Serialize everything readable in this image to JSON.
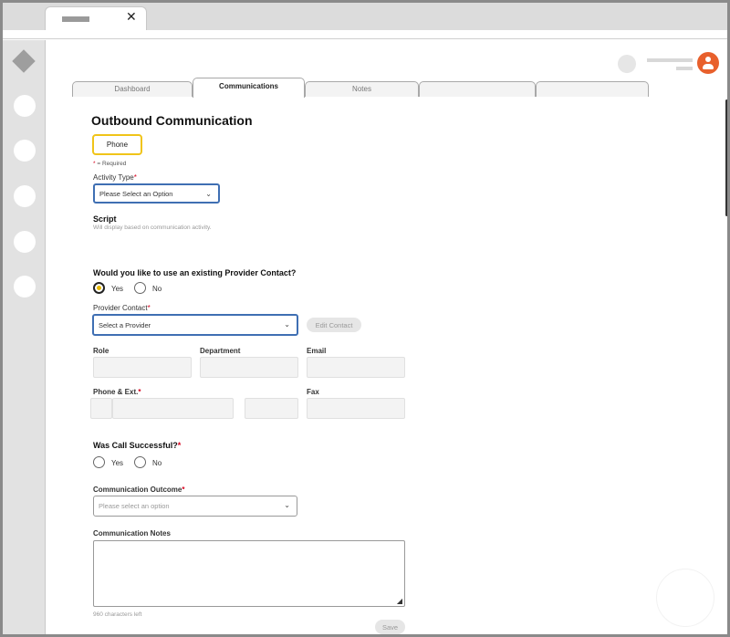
{
  "browser": {
    "tab_close": "✕"
  },
  "app_tabs": [
    {
      "label": "Dashboard"
    },
    {
      "label": "Communications"
    },
    {
      "label": "Notes"
    },
    {
      "label": ""
    },
    {
      "label": ""
    }
  ],
  "page": {
    "title": "Outbound Communication",
    "channel_button": "Phone",
    "required_marker": "*",
    "required_note": " = Required"
  },
  "activity": {
    "label": "Activity Type",
    "selected": "Please Select an Option"
  },
  "script": {
    "title": "Script",
    "hint": "Will display based on communication activity."
  },
  "provider": {
    "question": "Would you like to use an existing Provider Contact?",
    "yes": "Yes",
    "no": "No",
    "selected_option": "Yes",
    "contact_label": "Provider Contact",
    "contact_selected": "Select a Provider",
    "edit_button": "Edit Contact",
    "role_label": "Role",
    "department_label": "Department",
    "email_label": "Email",
    "phone_label": "Phone & Ext.",
    "fax_label": "Fax"
  },
  "call": {
    "question": "Was Call Successful?",
    "yes": "Yes",
    "no": "No"
  },
  "outcome": {
    "label": "Communication Outcome",
    "placeholder": "Please select an option"
  },
  "notes": {
    "label": "Communication Notes",
    "counter": "960 characters left"
  },
  "save_button": "Save",
  "icons": {
    "chevron": "⌄",
    "resize": "◢"
  },
  "colors": {
    "accent_yellow": "#f0c419",
    "focus_blue": "#3f6fb3",
    "required_red": "#d6001c",
    "avatar_orange": "#e8602c"
  }
}
